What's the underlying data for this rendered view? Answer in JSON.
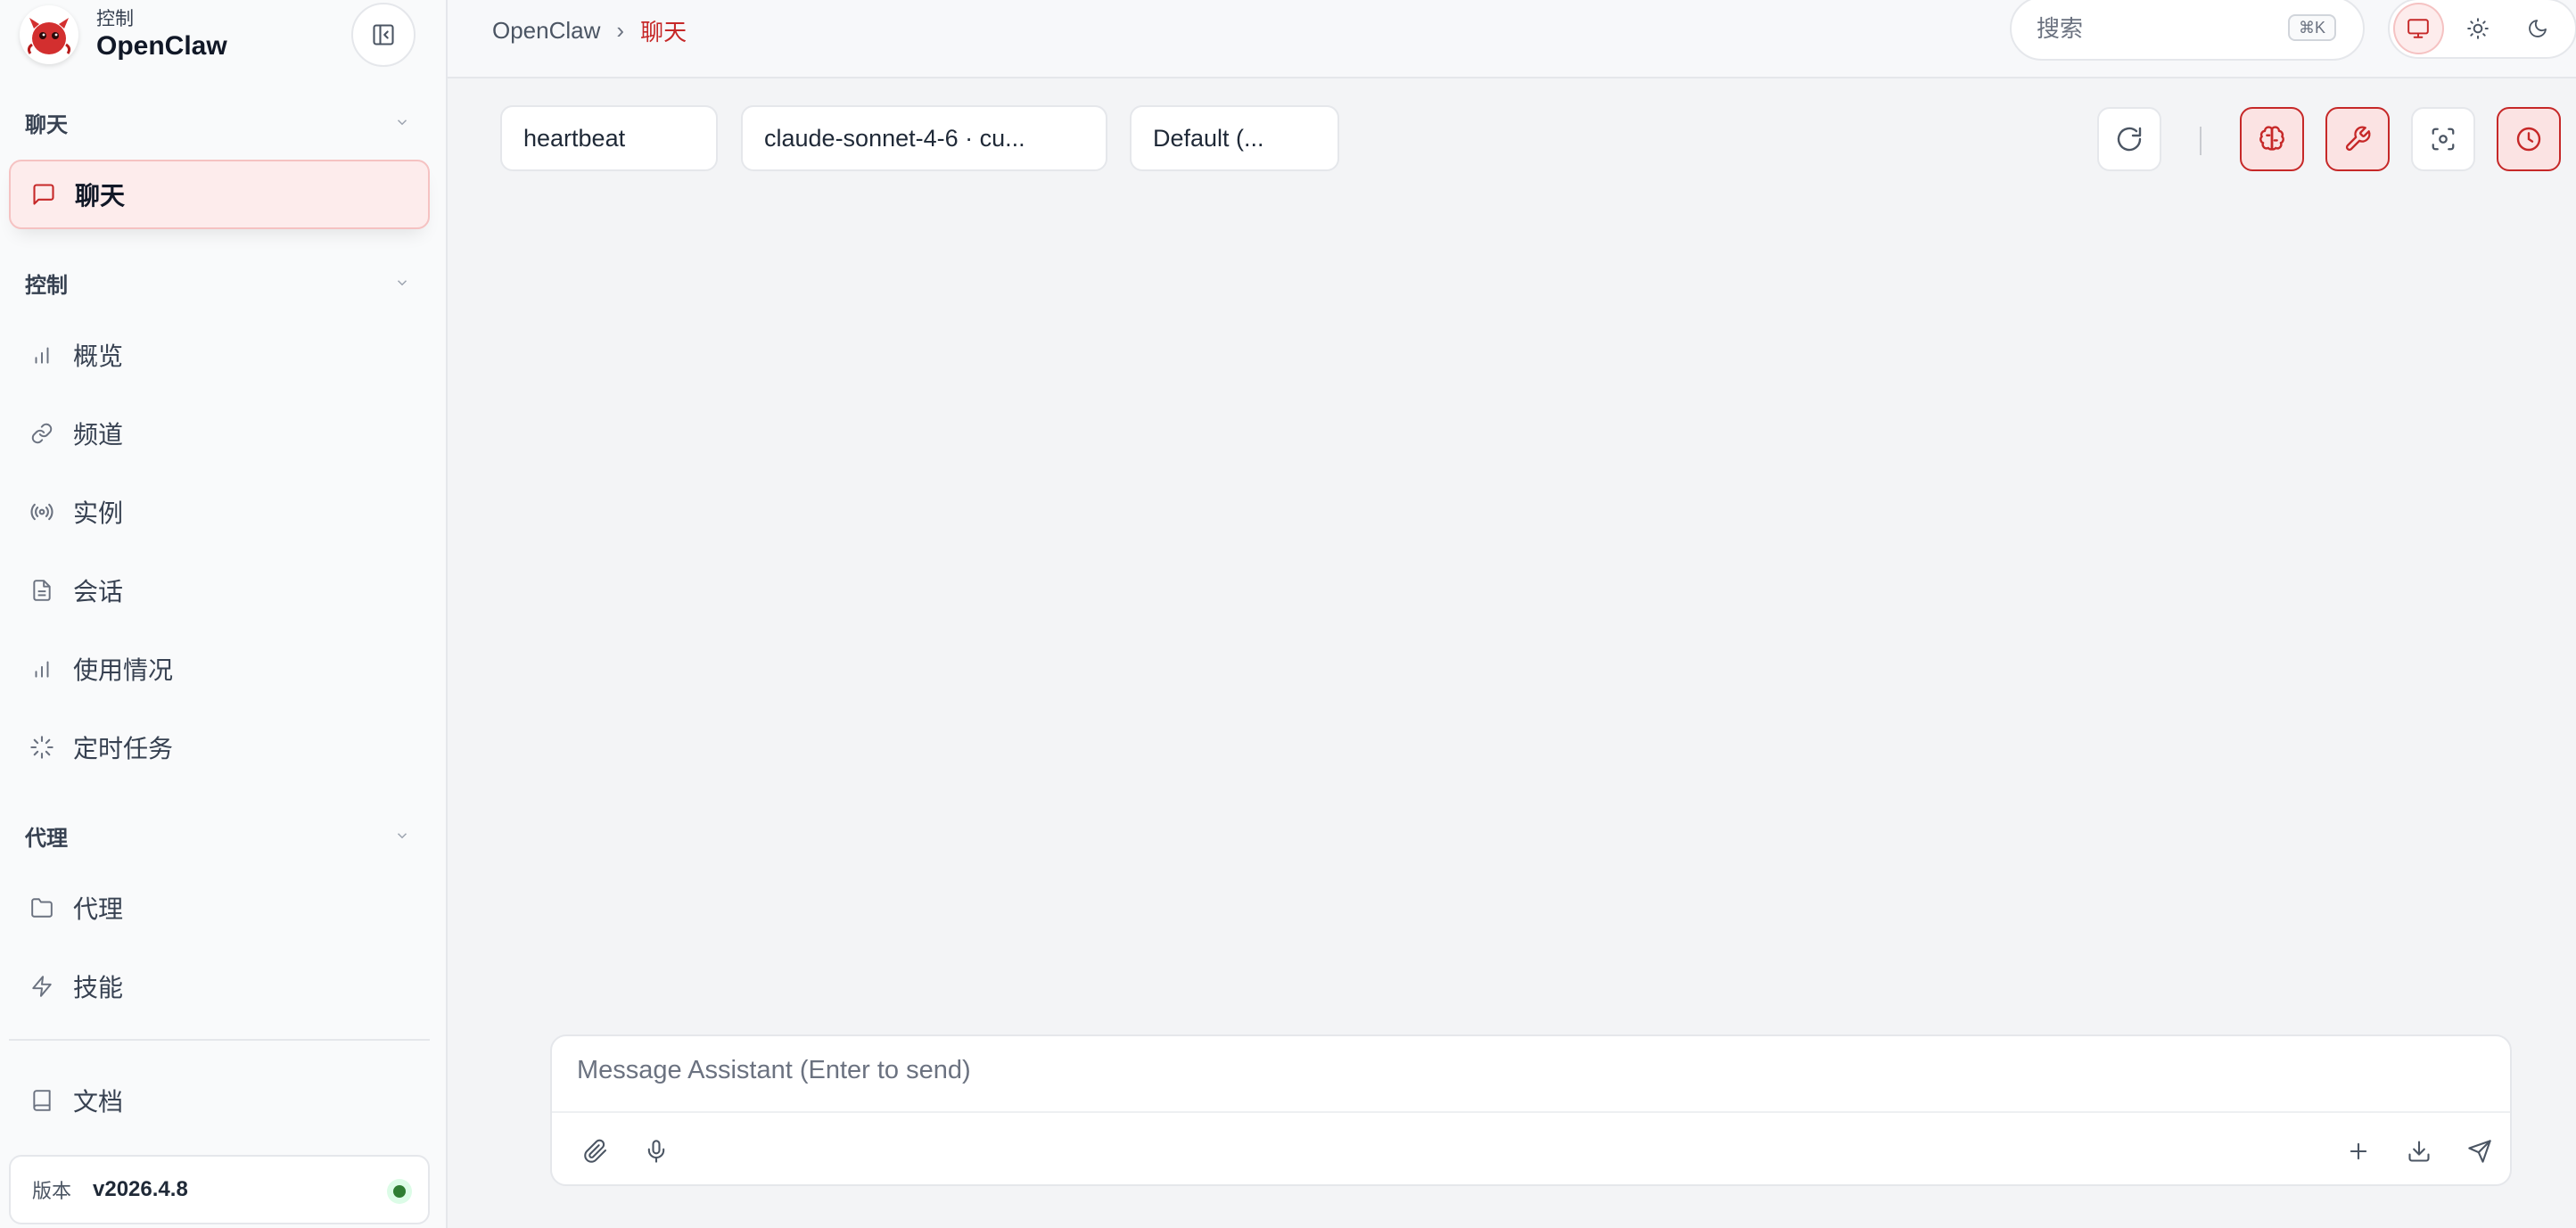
{
  "brand": {
    "subtitle": "控制",
    "title": "OpenClaw"
  },
  "sidebar": {
    "sections": [
      {
        "label": "聊天"
      },
      {
        "label": "控制"
      },
      {
        "label": "代理"
      }
    ],
    "items": [
      {
        "label": "聊天",
        "icon": "message-square-icon",
        "active": true
      },
      {
        "label": "概览",
        "icon": "bar-chart-icon"
      },
      {
        "label": "频道",
        "icon": "link-icon"
      },
      {
        "label": "实例",
        "icon": "radio-icon"
      },
      {
        "label": "会话",
        "icon": "file-text-icon"
      },
      {
        "label": "使用情况",
        "icon": "bar-chart-icon"
      },
      {
        "label": "定时任务",
        "icon": "loader-icon"
      },
      {
        "label": "代理",
        "icon": "folder-icon"
      },
      {
        "label": "技能",
        "icon": "zap-icon"
      },
      {
        "label": "文档",
        "icon": "book-icon"
      }
    ],
    "version": {
      "label": "版本",
      "value": "v2026.4.8",
      "status_color": "#2e7d32"
    }
  },
  "breadcrumb": {
    "root": "OpenClaw",
    "separator": "›",
    "current": "聊天"
  },
  "search": {
    "placeholder": "搜索",
    "shortcut": "⌘K"
  },
  "theme": {
    "options": [
      "system",
      "light",
      "dark"
    ],
    "selected": "system"
  },
  "chat": {
    "session_select": "heartbeat",
    "model_select": "claude-sonnet-4-6 · cu...",
    "thinking_select": "Default (...",
    "composer_placeholder": "Message Assistant (Enter to send)"
  },
  "colors": {
    "accent": "#c62828",
    "accent_soft": "#fdecec",
    "status_ok": "#2e7d32"
  }
}
